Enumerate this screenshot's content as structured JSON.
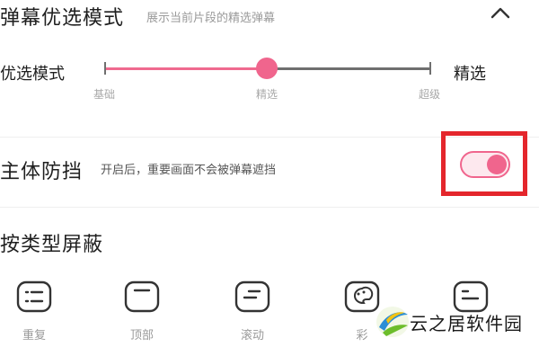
{
  "header": {
    "title": "弹幕优选模式",
    "subtitle": "展示当前片段的精选弹幕",
    "collapse_icon": "chevron-up-icon"
  },
  "mode_slider": {
    "label": "优选模式",
    "value_text": "精选",
    "levels": [
      "基础",
      "精选",
      "超级"
    ],
    "selected_index": 1,
    "accent_color": "#f0658d"
  },
  "protection": {
    "title": "主体防挡",
    "description": "开启后，重要画面不会被弹幕遮挡",
    "enabled": true,
    "highlight_color": "#e4262c"
  },
  "filter_by_type": {
    "title": "按类型屏蔽",
    "items": [
      {
        "label": "重复",
        "icon": "list-icon"
      },
      {
        "label": "顶部",
        "icon": "top-danmaku-icon"
      },
      {
        "label": "滚动",
        "icon": "scroll-danmaku-icon"
      },
      {
        "label": "彩",
        "icon": "palette-icon"
      },
      {
        "label": "",
        "icon": "card-icon"
      }
    ]
  },
  "watermark": {
    "text": "云之居软件园"
  }
}
